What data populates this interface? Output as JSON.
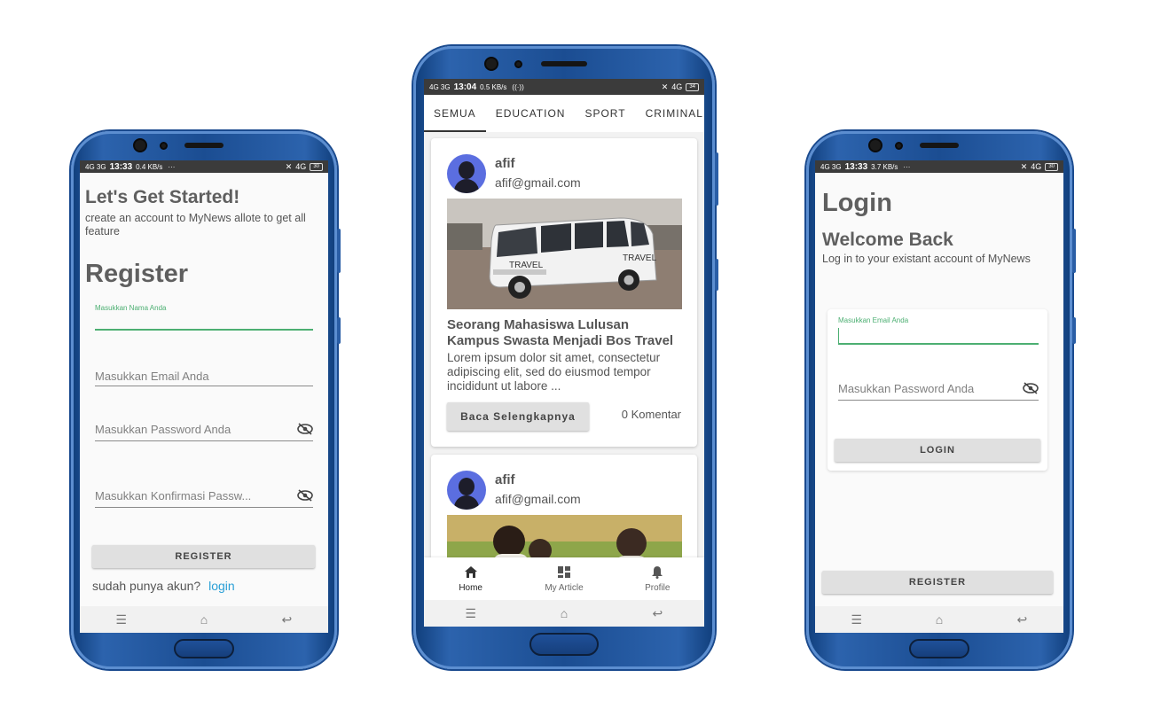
{
  "colors": {
    "phone_body": "#1b4d92",
    "accent_green": "#4caf72",
    "link_blue": "#2a9fd6",
    "button_gray": "#e0e0e0"
  },
  "register_phone": {
    "status": {
      "signal": "4G 3G",
      "time": "13:33",
      "speed": "0.4 KB/s",
      "more": "···",
      "right": "4G",
      "battery": "30"
    },
    "heading": "Let's Get Started!",
    "subtitle": "create an account to MyNews allote to get all feature",
    "title": "Register",
    "name_label": "Masukkan Nama Anda",
    "email_placeholder": "Masukkan Email Anda",
    "password_placeholder": "Masukkan Password Anda",
    "confirm_placeholder": "Masukkan Konfirmasi Passw...",
    "register_button": "REGISTER",
    "have_account": "sudah punya akun?",
    "login_link": "login",
    "nav": [
      "menu-icon",
      "home-icon",
      "back-icon"
    ]
  },
  "news_phone": {
    "status": {
      "signal": "4G 3G",
      "time": "13:04",
      "speed": "0.5 KB/s",
      "right": "4G",
      "battery": "34"
    },
    "tabs": [
      "SEMUA",
      "EDUCATION",
      "SPORT",
      "CRIMINAL"
    ],
    "active_tab": "SEMUA",
    "articles": [
      {
        "author": "afif",
        "email": "afif@gmail.com",
        "image": "travel-van",
        "headline": "Seorang Mahasiswa Lulusan Kampus Swasta Menjadi Bos Travel",
        "excerpt": "Lorem ipsum dolor sit amet, consectetur adipiscing elit, sed do eiusmod tempor incididunt ut labore ...",
        "read_button": "Baca Selengkapnya",
        "comments": "0 Komentar"
      },
      {
        "author": "afif",
        "email": "afif@gmail.com",
        "image": "people-outdoors"
      }
    ],
    "van_label_side": "TRAVEL",
    "van_label_back": "TRAVEL",
    "bottom_nav": [
      {
        "label": "Home",
        "icon": "home-icon",
        "active": true
      },
      {
        "label": "My Article",
        "icon": "dashboard-icon",
        "active": false
      },
      {
        "label": "Profile",
        "icon": "bell-icon",
        "active": false
      }
    ]
  },
  "login_phone": {
    "status": {
      "signal": "4G 3G",
      "time": "13:33",
      "speed": "3.7 KB/s",
      "more": "···",
      "right": "4G",
      "battery": "30"
    },
    "title": "Login",
    "heading": "Welcome Back",
    "subtitle": "Log in to your existant account of MyNews",
    "email_label": "Masukkan Email Anda",
    "password_placeholder": "Masukkan Password Anda",
    "login_button": "LOGIN",
    "register_button": "REGISTER"
  }
}
